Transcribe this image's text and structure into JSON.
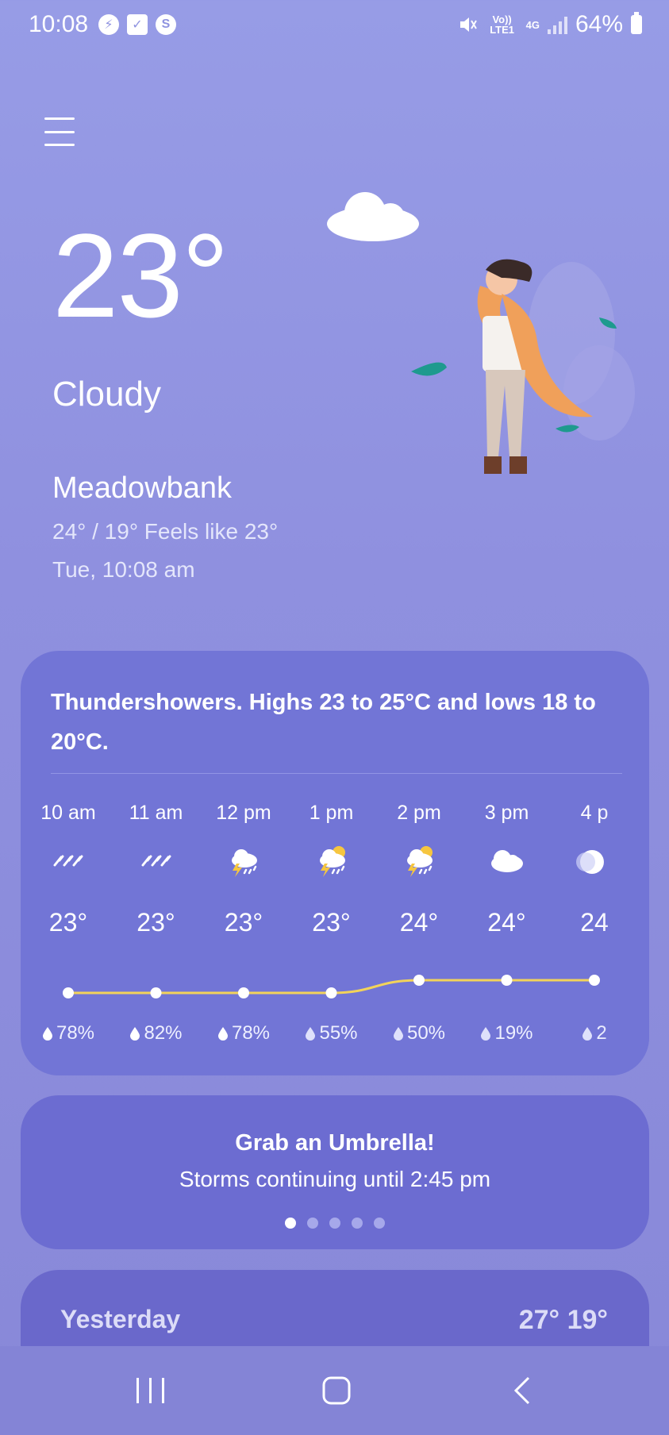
{
  "status_bar": {
    "time": "10:08",
    "notification_icons": [
      "messenger-icon",
      "checkbox-icon",
      "shazam-icon"
    ],
    "volte_label": "Vo)) LTE1",
    "network_label": "4G",
    "battery": "64%"
  },
  "weather": {
    "temperature": "23°",
    "condition": "Cloudy",
    "location": "Meadowbank",
    "range_feels": "24° / 19° Feels like 23°",
    "datetime": "Tue, 10:08 am"
  },
  "forecast": {
    "summary": "Thundershowers. Highs 23 to 25°C and lows 18 to 20°C.",
    "trend_values": [
      23,
      23,
      23,
      23,
      24,
      24,
      24
    ],
    "hours": [
      {
        "time": "10 am",
        "icon": "rain-icon",
        "temp": "23°",
        "precip": "78%"
      },
      {
        "time": "11 am",
        "icon": "rain-icon",
        "temp": "23°",
        "precip": "82%"
      },
      {
        "time": "12 pm",
        "icon": "thunderstorm-icon",
        "temp": "23°",
        "precip": "78%"
      },
      {
        "time": "1 pm",
        "icon": "thunderstorm-sun-icon",
        "temp": "23°",
        "precip": "55%"
      },
      {
        "time": "2 pm",
        "icon": "thunderstorm-sun-icon",
        "temp": "24°",
        "precip": "50%"
      },
      {
        "time": "3 pm",
        "icon": "cloud-icon",
        "temp": "24°",
        "precip": "19%"
      },
      {
        "time": "4 p",
        "icon": "moon-cloud-icon",
        "temp": "24",
        "precip": "2"
      }
    ]
  },
  "alert": {
    "title": "Grab an Umbrella!",
    "text": "Storms continuing until 2:45 pm",
    "pages": 5,
    "active_page": 0
  },
  "yesterday": {
    "label": "Yesterday",
    "temps": "27° 19°"
  },
  "colors": {
    "background": "#8f90df",
    "card": "#7275d6",
    "trend_line": "#f2d35a"
  }
}
